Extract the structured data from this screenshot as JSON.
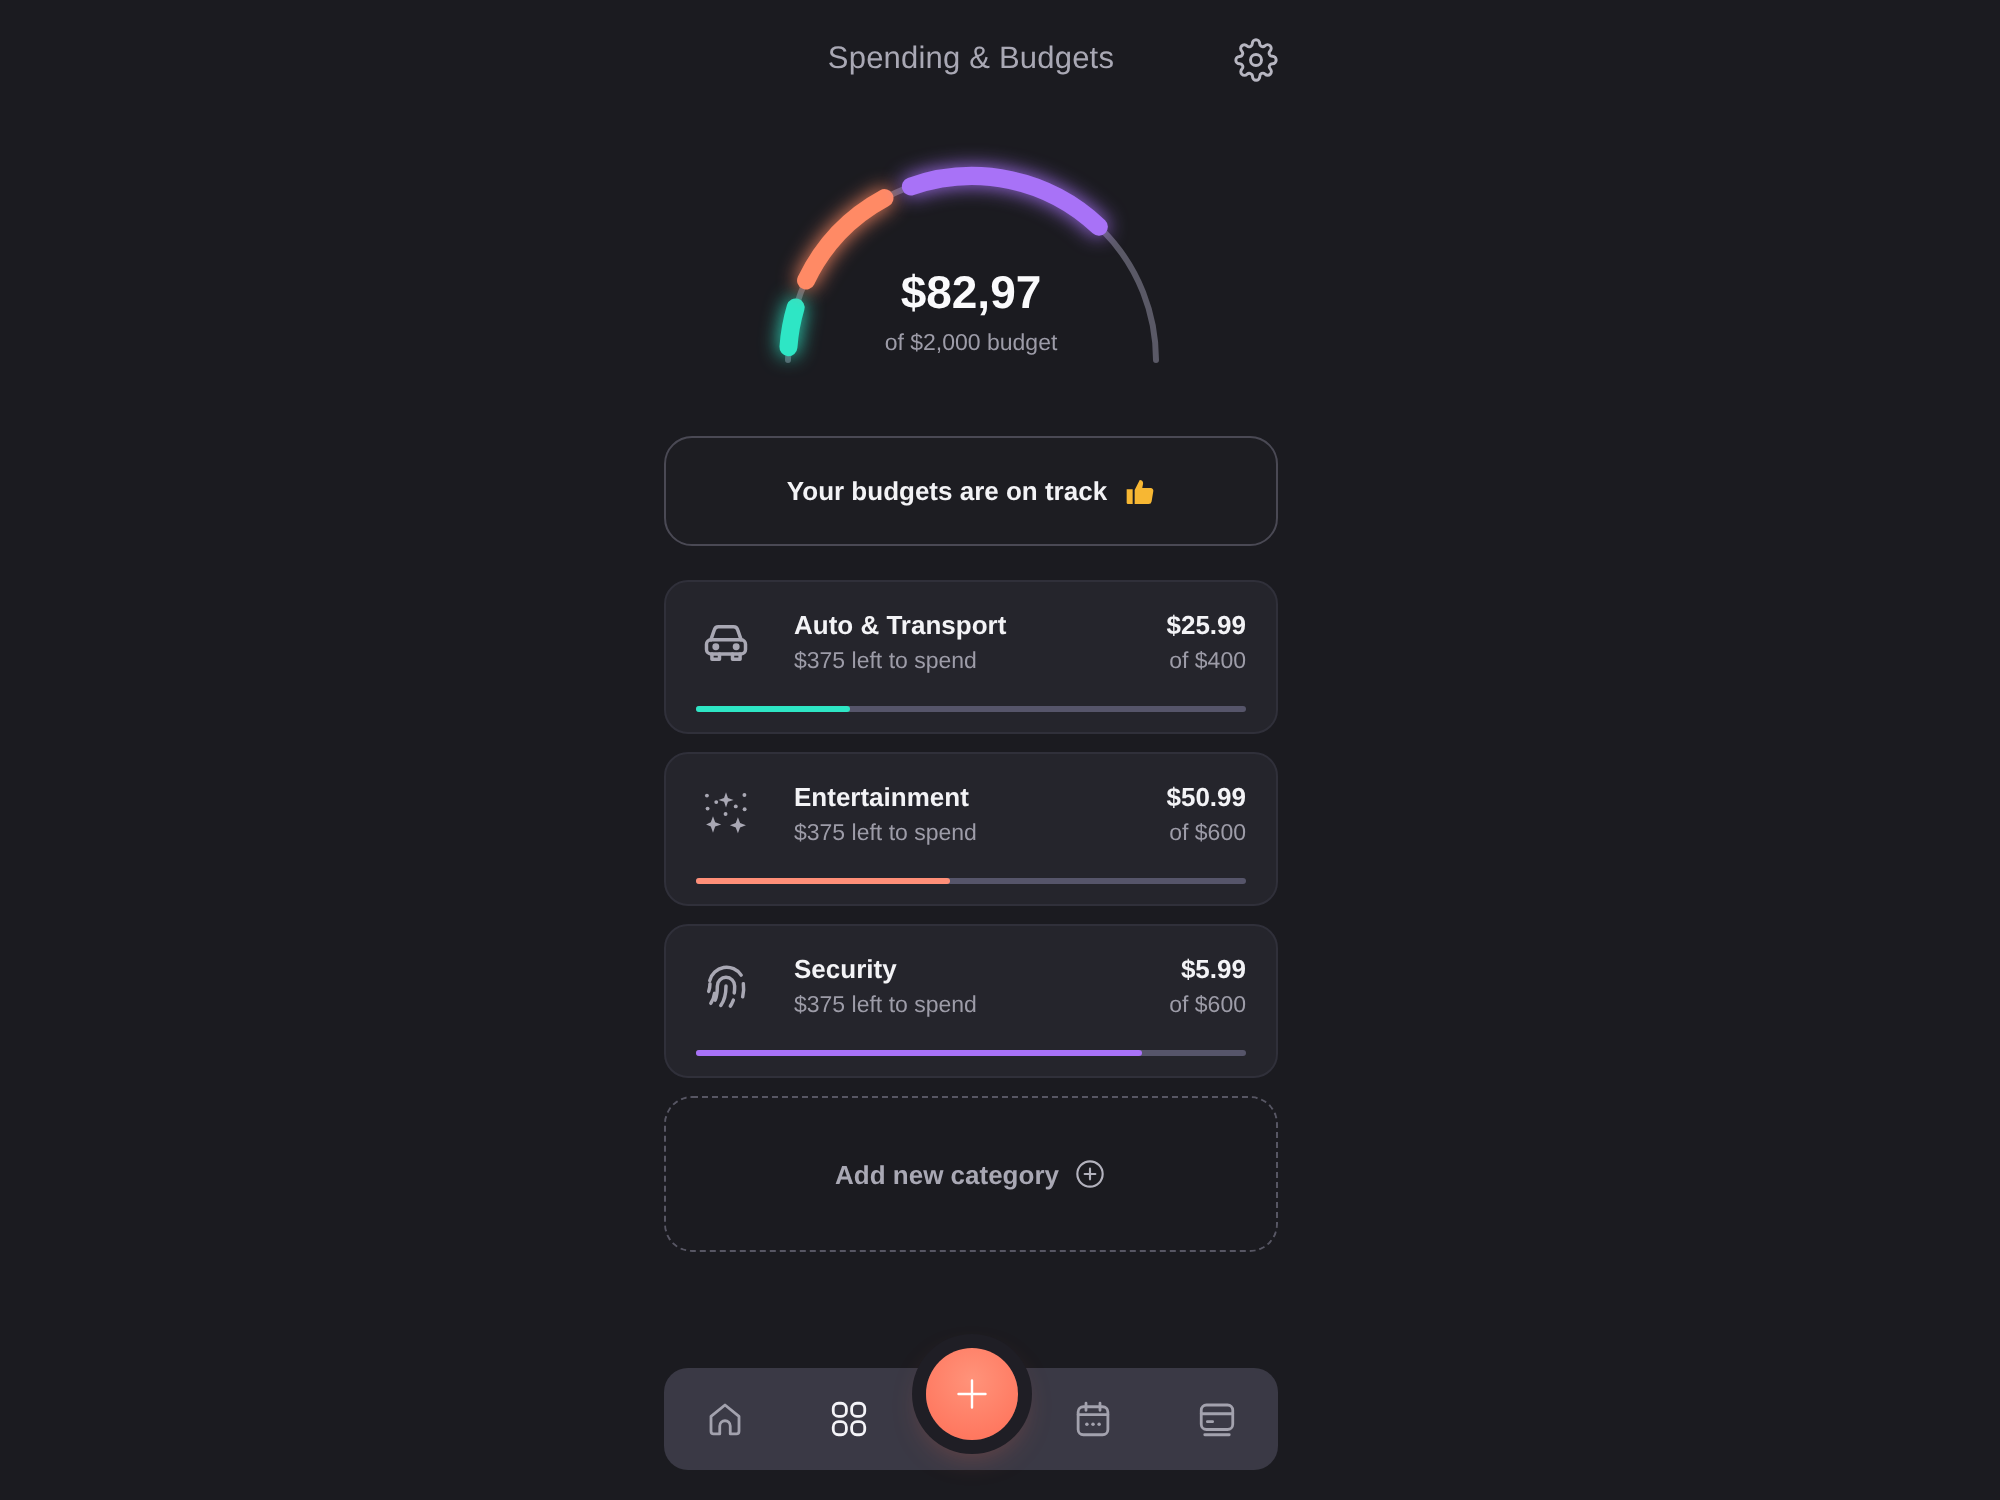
{
  "header": {
    "title": "Spending & Budgets"
  },
  "gauge": {
    "amount": "$82,97",
    "caption": "of $2,000 budget",
    "segments": [
      {
        "color": "#2ee6c5"
      },
      {
        "color": "#ff8a65"
      },
      {
        "color": "#a872f7"
      }
    ]
  },
  "status": {
    "message": "Your budgets are on track"
  },
  "categories": [
    {
      "kind": "car",
      "name": "Auto & Transport",
      "remaining": "$375 left to spend",
      "spent": "$25.99",
      "limit": "of $400",
      "level": 0.28,
      "color": "#2ee6c5"
    },
    {
      "kind": "sparkles",
      "name": "Entertainment",
      "remaining": "$375 left to spend",
      "spent": "$50.99",
      "limit": "of $600",
      "level": 0.46,
      "color": "#ff8f78"
    },
    {
      "kind": "fingerprint",
      "name": "Security",
      "remaining": "$375 left to spend",
      "spent": "$5.99",
      "limit": "of $600",
      "level": 0.81,
      "color": "#a872f7"
    }
  ],
  "add_category": {
    "label": "Add new category"
  },
  "nav": {
    "items": [
      {
        "kind": "home",
        "selected": false
      },
      {
        "kind": "grid",
        "selected": true
      },
      {
        "kind": "calendar",
        "selected": false
      },
      {
        "kind": "card",
        "selected": false
      }
    ]
  }
}
